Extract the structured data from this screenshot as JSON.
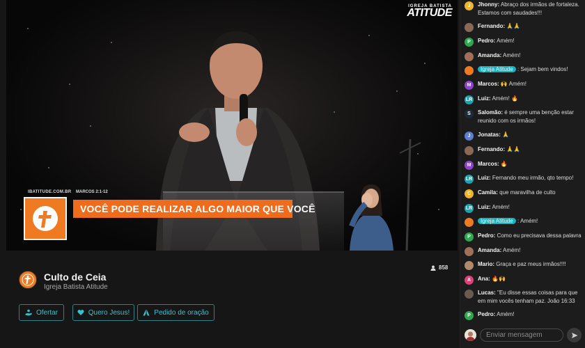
{
  "video": {
    "brand_small": "IGREJA BATISTA",
    "brand_big": "ATITUDE",
    "site": "IBATITUDE.COM.BR",
    "verse_ref": "MARCOS 2:1-12",
    "headline": "VOCÊ PODE REALIZAR ALGO MAIOR QUE VOCÊ"
  },
  "stream": {
    "title": "Culto de Ceia",
    "channel": "Igreja Batista Atitude",
    "viewers": "858"
  },
  "actions": {
    "ofertar": "Ofertar",
    "quero_jesus": "Quero Jesus!",
    "pedido": "Pedido de oração"
  },
  "chat": {
    "messages": [
      {
        "name": "Jhonny:",
        "text": "Abraço dos irmãos de fortaleza. Estamos com saudades!!!",
        "initial": "J",
        "color": "#f0b429"
      },
      {
        "name": "Fernando:",
        "text": "🙏🙏",
        "initial": "",
        "color": "#8a6a55"
      },
      {
        "name": "Pedro:",
        "text": "Amém!",
        "initial": "P",
        "color": "#2fa84f"
      },
      {
        "name": "Amanda:",
        "text": "Amém!",
        "initial": "",
        "color": "#a0705a"
      },
      {
        "name": "Igreja Atitude",
        "text": ": Sejam bem vindos!",
        "initial": "",
        "color": "#f07a21",
        "mod": true
      },
      {
        "name": "Marcos:",
        "text": "🙌 Amém!",
        "initial": "M",
        "color": "#8e44c9"
      },
      {
        "name": "Luiz:",
        "text": "Amém! 🔥",
        "initial": "LR",
        "color": "#13a6b5"
      },
      {
        "name": "Salomão:",
        "text": "é sempre uma benção estar reunido com os irmãos!",
        "initial": "S",
        "color": "#1e2a3a"
      },
      {
        "name": "Jonatas:",
        "text": "🙏",
        "initial": "J",
        "color": "#5b7fd6"
      },
      {
        "name": "Fernando:",
        "text": "🙏🙏",
        "initial": "",
        "color": "#8a6a55"
      },
      {
        "name": "Marcos:",
        "text": "🔥",
        "initial": "M",
        "color": "#8e44c9"
      },
      {
        "name": "Luiz:",
        "text": "Fernando meu irmão, qto tempo!",
        "initial": "LR",
        "color": "#13a6b5"
      },
      {
        "name": "Camila:",
        "text": "que maravilha de culto",
        "initial": "C",
        "color": "#f0b429"
      },
      {
        "name": "Luiz:",
        "text": "Amém!",
        "initial": "LR",
        "color": "#13a6b5"
      },
      {
        "name": "Igreja Atitude",
        "text": ": Amém!",
        "initial": "",
        "color": "#f07a21",
        "mod": true
      },
      {
        "name": "Pedro:",
        "text": "Como eu precisava dessa palavra",
        "initial": "P",
        "color": "#2fa84f"
      },
      {
        "name": "Amanda:",
        "text": "Amém!",
        "initial": "",
        "color": "#a0705a"
      },
      {
        "name": "Mario:",
        "text": "Graça e paz meus irmãos!!!!",
        "initial": "",
        "color": "#b08a6a"
      },
      {
        "name": "Ana:",
        "text": "🔥🙌",
        "initial": "A",
        "color": "#e0407a"
      },
      {
        "name": "Lucas:",
        "text": "\"Eu disse essas coisas para que em mim vocês tenham paz. João 16:33",
        "initial": "",
        "color": "#6b5a50"
      },
      {
        "name": "Pedro:",
        "text": "Amém!",
        "initial": "P",
        "color": "#2fa84f"
      }
    ],
    "input_placeholder": "Enviar mensagem"
  },
  "colors": {
    "accent": "#1ab0bd",
    "brand_orange": "#ef6c1d"
  }
}
